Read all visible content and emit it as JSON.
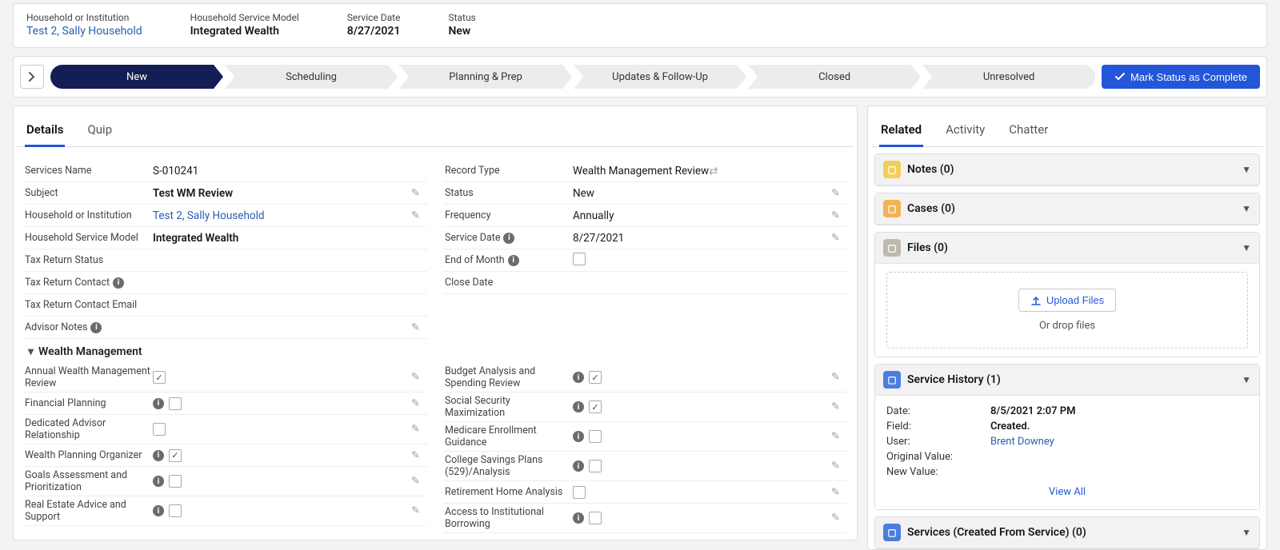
{
  "header": {
    "fields": [
      {
        "label": "Household or Institution",
        "value": "Test 2, Sally Household",
        "link": true
      },
      {
        "label": "Household Service Model",
        "value": "Integrated Wealth",
        "bold": true
      },
      {
        "label": "Service Date",
        "value": "8/27/2021",
        "bold": true
      },
      {
        "label": "Status",
        "value": "New",
        "bold": true
      }
    ]
  },
  "path": {
    "stages": [
      "New",
      "Scheduling",
      "Planning & Prep",
      "Updates & Follow-Up",
      "Closed",
      "Unresolved"
    ],
    "active": 0,
    "button": "Mark Status as Complete"
  },
  "leftTabs": [
    "Details",
    "Quip"
  ],
  "rightTabs": [
    "Related",
    "Activity",
    "Chatter"
  ],
  "details": {
    "left": [
      {
        "label": "Services Name",
        "value": "S-010241",
        "edit": false
      },
      {
        "label": "Subject",
        "value": "Test WM Review",
        "bold": true,
        "edit": true
      },
      {
        "label": "Household or Institution",
        "value": "Test 2, Sally Household",
        "link": true,
        "edit": true
      },
      {
        "label": "Household Service Model",
        "value": "Integrated Wealth",
        "bold": true,
        "edit": false
      },
      {
        "label": "Tax Return Status",
        "value": "",
        "edit": false
      },
      {
        "label": "Tax Return Contact",
        "value": "",
        "info": true,
        "edit": false
      },
      {
        "label": "Tax Return Contact Email",
        "value": "",
        "edit": false
      },
      {
        "label": "Advisor Notes",
        "value": "",
        "info": true,
        "edit": true
      }
    ],
    "right": [
      {
        "label": "Record Type",
        "value": "Wealth Management Review",
        "rt": true
      },
      {
        "label": "Status",
        "value": "New",
        "edit": true
      },
      {
        "label": "Frequency",
        "value": "Annually",
        "edit": true
      },
      {
        "label": "Service Date",
        "value": "8/27/2021",
        "info": true,
        "edit": true
      },
      {
        "label": "End of Month",
        "value": "",
        "checkbox": true,
        "checked": false,
        "info": true,
        "edit": false
      },
      {
        "label": "Close Date",
        "value": "",
        "edit": false
      }
    ]
  },
  "wealthSection": {
    "title": "Wealth Management",
    "left": [
      {
        "label": "Annual Wealth Management Review",
        "checked": true
      },
      {
        "label": "Financial Planning",
        "checked": false,
        "info": true
      },
      {
        "label": "Dedicated Advisor Relationship",
        "checked": false
      },
      {
        "label": "Wealth Planning Organizer",
        "checked": true,
        "info": true
      },
      {
        "label": "Goals Assessment and Prioritization",
        "checked": false,
        "info": true
      },
      {
        "label": "Real Estate Advice and Support",
        "checked": false,
        "info": true
      }
    ],
    "right": [
      {
        "label": "Budget Analysis and Spending Review",
        "checked": true,
        "info": true
      },
      {
        "label": "Social Security Maximization",
        "checked": true,
        "info": true
      },
      {
        "label": "Medicare Enrollment Guidance",
        "checked": false,
        "info": true
      },
      {
        "label": "College Savings Plans (529)/Analysis",
        "checked": false,
        "info": true
      },
      {
        "label": "Retirement Home Analysis",
        "checked": false
      },
      {
        "label": "Access to Institutional Borrowing",
        "checked": false,
        "info": true
      }
    ]
  },
  "related": {
    "notes": {
      "title": "Notes (0)",
      "color": "#f2cf5b"
    },
    "cases": {
      "title": "Cases (0)",
      "color": "#f2b355"
    },
    "files": {
      "title": "Files (0)",
      "color": "#bdb9b0",
      "upload": "Upload Files",
      "drop": "Or drop files"
    },
    "history": {
      "title": "Service History (1)",
      "color": "#4a7de0",
      "rows": [
        {
          "k": "Date:",
          "v": "8/5/2021 2:07 PM"
        },
        {
          "k": "Field:",
          "v": "Created."
        },
        {
          "k": "User:",
          "v": "Brent Downey",
          "link": true
        },
        {
          "k": "Original Value:",
          "v": ""
        },
        {
          "k": "New Value:",
          "v": ""
        }
      ],
      "viewAll": "View All"
    },
    "services": {
      "title": "Services (Created From Service) (0)",
      "color": "#4a7de0"
    }
  }
}
